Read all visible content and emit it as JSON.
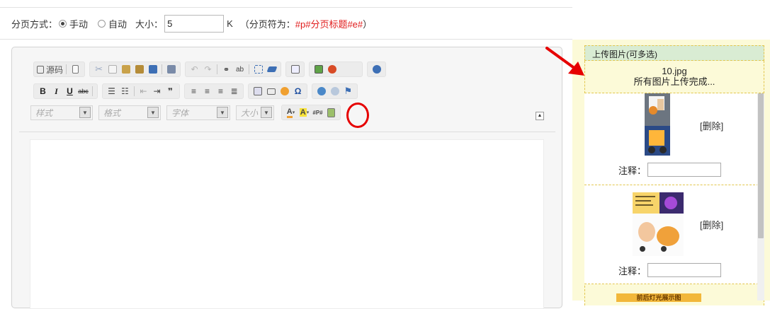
{
  "paging": {
    "label": "分页方式：",
    "manual": "手动",
    "auto": "自动",
    "size_label": "大小：",
    "size_value": "5",
    "size_unit": "K",
    "separator_hint_open": "（分页符为：",
    "separator_hint_value": "#p#分页标题#e#",
    "separator_hint_close": "）",
    "selected": "manual"
  },
  "toolbar": {
    "source_label": "源码",
    "bold": "B",
    "italic": "I",
    "underline": "U",
    "strike": "abc",
    "quote": "❞",
    "omega": "Ω",
    "pagebreak": "#P#",
    "style_combo": "样式",
    "format_combo": "格式",
    "font_combo": "字体",
    "size_combo": "大小"
  },
  "upload": {
    "header": "上传图片(可多选)",
    "filename": "10.jpg",
    "status": "所有图片上传完成..."
  },
  "images": [
    {
      "delete_label": "[删除]",
      "note_label": "注释："
    },
    {
      "delete_label": "[删除]",
      "note_label": "注释："
    }
  ],
  "partial_banner": "前后灯光展示图",
  "colors": {
    "hint": "#e01b1b",
    "arrow": "#e60000",
    "panel_bg": "#fcfad8",
    "header_bg": "#d9ecd3"
  }
}
